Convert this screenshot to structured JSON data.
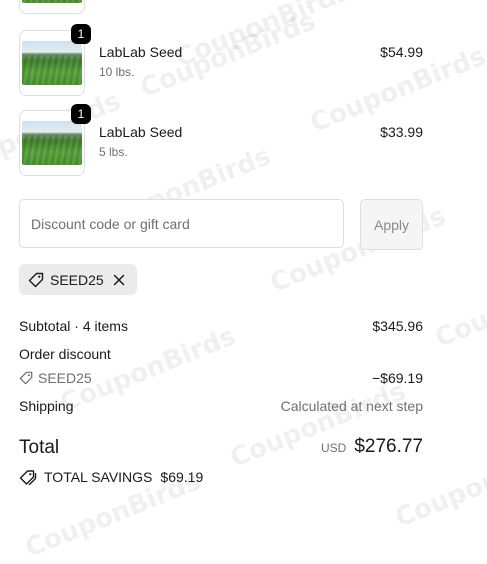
{
  "items": [
    {
      "name": "LabLab Seed",
      "variant": "10 lbs.",
      "price": "$54.99",
      "quantity": "1"
    },
    {
      "name": "LabLab Seed",
      "variant": "5 lbs.",
      "price": "$33.99",
      "quantity": "1"
    }
  ],
  "discount": {
    "placeholder": "Discount code or gift card",
    "apply_label": "Apply",
    "applied_code": "SEED25"
  },
  "summary": {
    "subtotal_label": "Subtotal · 4 items",
    "subtotal_value": "$345.96",
    "order_discount_label": "Order discount",
    "discount_code": "SEED25",
    "discount_value": "−$69.19",
    "shipping_label": "Shipping",
    "shipping_value": "Calculated at next step",
    "total_label": "Total",
    "currency": "USD",
    "total_value": "$276.77",
    "savings_label": "TOTAL SAVINGS",
    "savings_value": "$69.19"
  },
  "watermark": "CouponBirds",
  "icons": [
    "tag-icon",
    "close-icon",
    "tag-icon",
    "tags-icon"
  ]
}
